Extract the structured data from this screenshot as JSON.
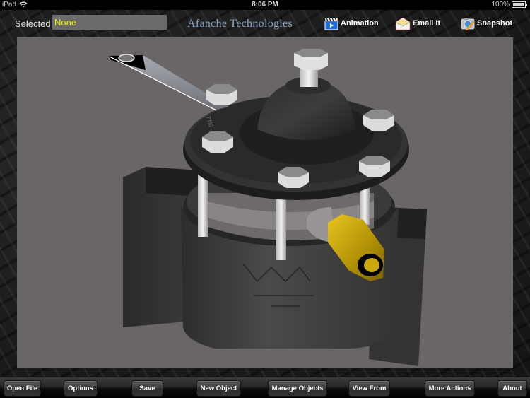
{
  "status_bar": {
    "device": "iPad",
    "wifi_icon": "wifi-icon",
    "time": "8:06 PM",
    "battery_text": "100%",
    "battery_level": 1.0
  },
  "header": {
    "selected_label": "Selected",
    "selected_value": "None",
    "brand": "Afanche Technologies",
    "actions": [
      {
        "label": "Animation",
        "icon": "clapperboard-icon"
      },
      {
        "label": "Email It",
        "icon": "envelope-icon"
      },
      {
        "label": "Snapshot",
        "icon": "camera-icon"
      }
    ]
  },
  "viewport": {
    "model": "3D valve assembly",
    "background_color": "#6a6566",
    "fitting_color": "#c9a80e",
    "engraving": "7Tl6"
  },
  "toolbar": {
    "buttons": [
      {
        "label": "Open File"
      },
      {
        "label": "Options"
      },
      {
        "label": "Save"
      },
      {
        "label": "New Object"
      },
      {
        "label": "Manage Objects"
      },
      {
        "label": "View From"
      },
      {
        "label": "More Actions"
      },
      {
        "label": "About"
      }
    ]
  }
}
